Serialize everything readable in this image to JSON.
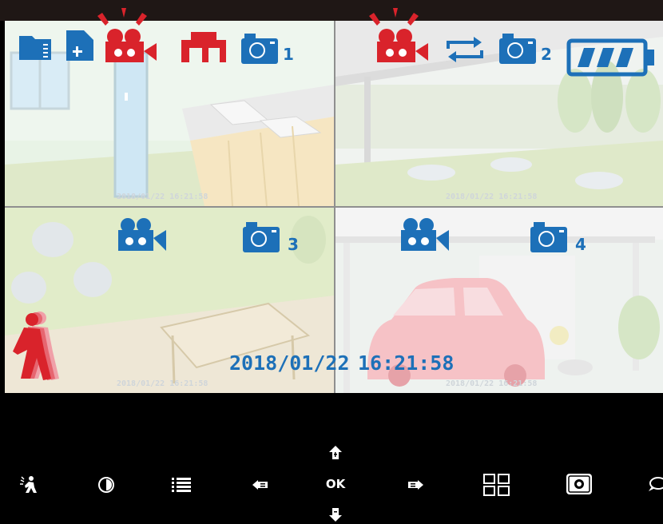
{
  "cameras": [
    {
      "id": "1",
      "timestamp": "2018/01/22  16:21:58",
      "recording": true
    },
    {
      "id": "2",
      "timestamp": "2018/01/22  16:21:58",
      "recording": true
    },
    {
      "id": "3",
      "timestamp": "2018/01/22  16:21:58",
      "recording": false
    },
    {
      "id": "4",
      "timestamp": "2018/01/22  16:21:58",
      "recording": false
    }
  ],
  "overlay": {
    "date": "2018/01/22",
    "time": "16:21:58"
  },
  "status": {
    "battery_bars": 3,
    "battery_max": 4
  },
  "toolbar": {
    "ok_label": "OK",
    "icons": [
      "motion-person-icon",
      "brightness-icon",
      "menu-list-icon",
      "previous-icon",
      "up-arrow-icon",
      "down-arrow-icon",
      "next-icon",
      "quad-view-icon",
      "snapshot-focus-icon",
      "speech-icon"
    ]
  },
  "colors": {
    "accent_blue": "#1d70b8",
    "alert_red": "#d9232b",
    "background": "#000000"
  }
}
